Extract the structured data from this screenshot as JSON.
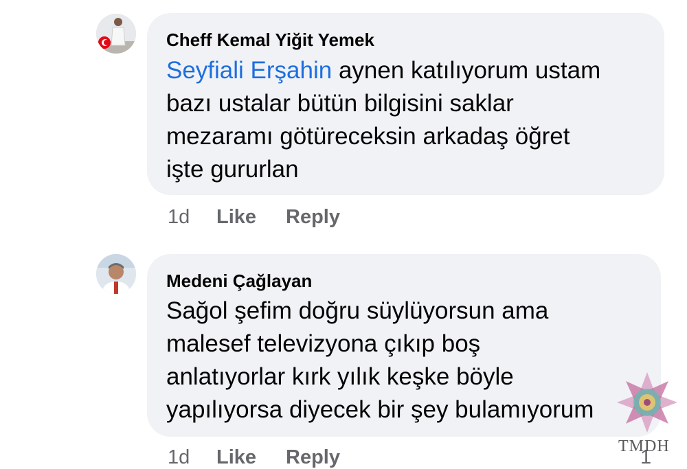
{
  "comments": [
    {
      "author": "Cheff Kemal Yiğit Yemek",
      "mention": "Seyfiali Erşahin",
      "lines": [
        " aynen katılıyorum ustam",
        "bazı ustalar bütün bilgisini saklar",
        "mezaramı götüreceksin arkadaş öğret",
        "işte gururlan"
      ],
      "time": "1d",
      "like_label": "Like",
      "reply_label": "Reply"
    },
    {
      "author": "Medeni Çağlayan",
      "lines": [
        "Sağol şefim doğru süylüyorsun ama",
        "malesef televizyona çıkıp boş",
        "anlatıyorlar kırk yılık keşke böyle",
        "yapılıyorsa diyecek bir şey bulamıyorum"
      ],
      "time": "1d",
      "like_label": "Like",
      "reply_label": "Reply",
      "reaction_count": "1"
    }
  ],
  "watermark": {
    "text": "TMDH",
    "icon": "ornament-icon"
  },
  "colors": {
    "bubble": "#f0f2f5",
    "mention": "#1d6fe0",
    "meta": "#65676b"
  }
}
